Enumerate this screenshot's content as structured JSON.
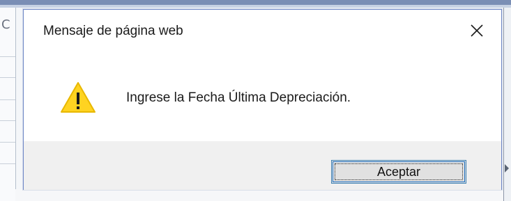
{
  "dialog": {
    "title": "Mensaje de página web",
    "message": "Ingrese la Fecha Última Depreciación.",
    "ok_label": "Aceptar",
    "close_icon": "close-icon",
    "warning_icon": "warning-icon"
  },
  "colors": {
    "warning_fill": "#ffd321",
    "warning_border": "#e8b800",
    "accent": "#1e6fc0",
    "footer": "#f0f0f0"
  }
}
